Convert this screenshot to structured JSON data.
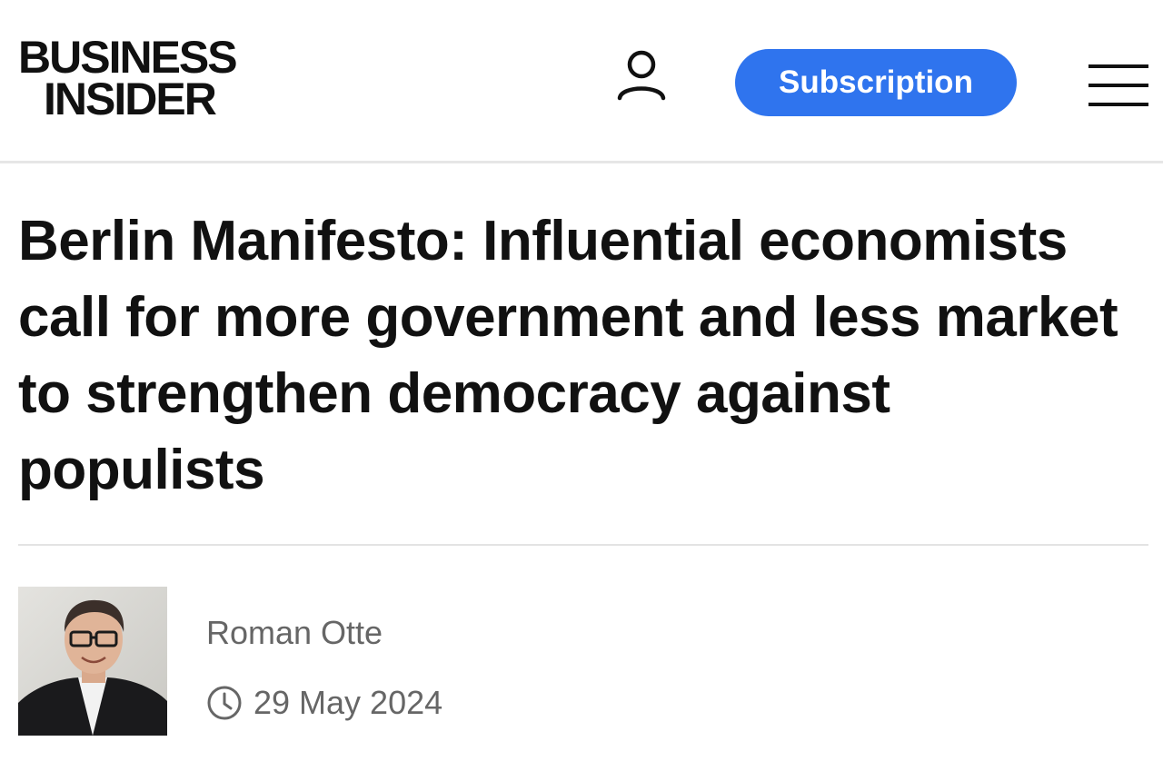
{
  "header": {
    "logo": {
      "line1": "BUSINESS",
      "line2": "INSIDER"
    },
    "account_icon": "user-icon",
    "subscribe_label": "Subscription",
    "menu_icon": "hamburger-menu-icon",
    "accent_color": "#2f74ee"
  },
  "article": {
    "headline": "Berlin Manifesto: Influential economists call for more government and less market to strengthen democracy against populists",
    "author": {
      "name": "Roman Otte",
      "photo_icon": "author-photo"
    },
    "date": "29 May 2024",
    "date_icon": "clock-icon"
  }
}
